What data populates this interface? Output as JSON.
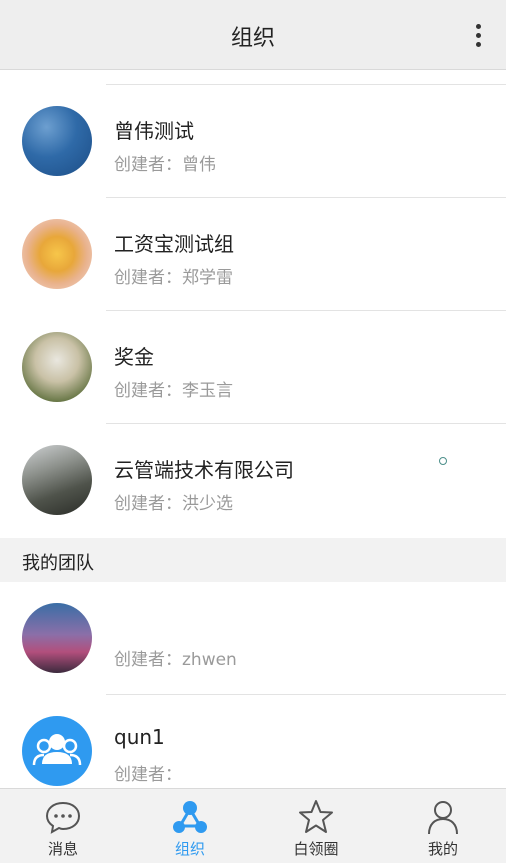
{
  "header": {
    "title": "组织"
  },
  "organizations": [
    {
      "name": "曾伟测试",
      "creator": "创建者：曾伟"
    },
    {
      "name": "工资宝测试组",
      "creator": "创建者：郑学雷"
    },
    {
      "name": "奖金",
      "creator": "创建者：李玉言"
    },
    {
      "name": "云管端技术有限公司",
      "creator": "创建者：洪少选"
    }
  ],
  "my_team": {
    "title": "我的团队",
    "items": [
      {
        "name": "",
        "creator": "创建者：zhwen"
      },
      {
        "name": "qun1",
        "creator": "创建者："
      }
    ]
  },
  "tabs": [
    {
      "label": "消息",
      "icon": "chat-bubble-icon"
    },
    {
      "label": "组织",
      "icon": "organization-nodes-icon"
    },
    {
      "label": "白领圈",
      "icon": "star-icon"
    },
    {
      "label": "我的",
      "icon": "person-icon"
    }
  ],
  "colors": {
    "accent": "#2f9af0",
    "header_bg": "#eeeeee",
    "tabbar_bg": "#f2f2f2"
  }
}
